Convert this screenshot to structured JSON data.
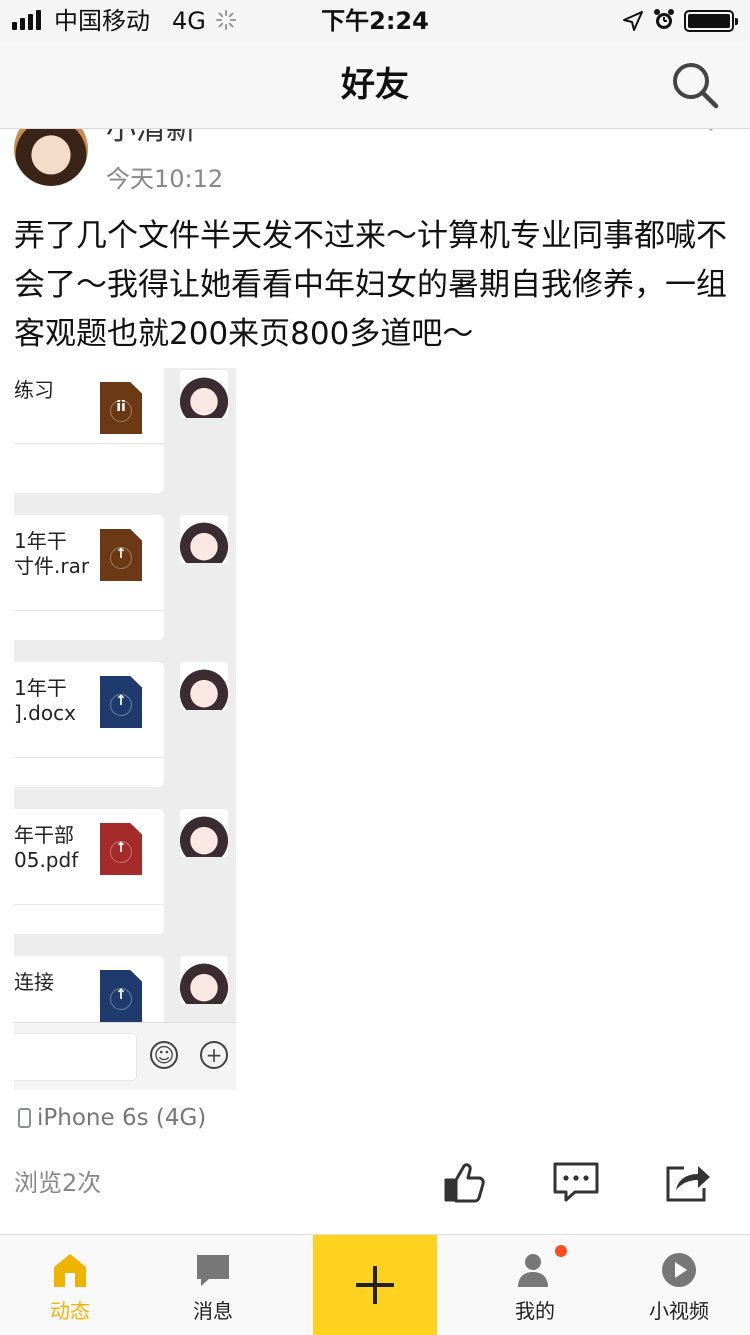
{
  "status_bar": {
    "carrier": "中国移动",
    "network": "4G",
    "time": "下午2:24"
  },
  "nav": {
    "title": "好友"
  },
  "post": {
    "author": "小清新",
    "time": "今天10:12",
    "text": "弄了几个文件半天发不过来～计算机专业同事都喊不会了～我得让她看看中年妇女的暑期自我修养，一组客观题也就200来页800多道吧～",
    "device": "iPhone 6s (4G)",
    "views": "浏览2次"
  },
  "chat_screenshot": {
    "files": [
      {
        "name": "练习",
        "icon_color": "#6b3a15",
        "glyph": "ii"
      },
      {
        "name": "1年干\n寸件.rar",
        "icon_color": "#6b3a15",
        "glyph": "↑"
      },
      {
        "name": "1年干\n].docx",
        "icon_color": "#1f3b6e",
        "glyph": "↑"
      },
      {
        "name": "年干部\n05.pdf",
        "icon_color": "#a52a2a",
        "glyph": "↑"
      },
      {
        "name": "连接",
        "icon_color": "#1f3b6e",
        "glyph": "↑"
      }
    ]
  },
  "tab_bar": {
    "items": [
      {
        "label": "动态",
        "active": true
      },
      {
        "label": "消息",
        "active": false
      },
      {
        "label": "我的",
        "active": false,
        "badge": true
      },
      {
        "label": "小视频",
        "active": false
      }
    ]
  },
  "colors": {
    "accent": "#ffd21f",
    "active_tab": "#f0b400",
    "badge": "#ff4d1f"
  }
}
